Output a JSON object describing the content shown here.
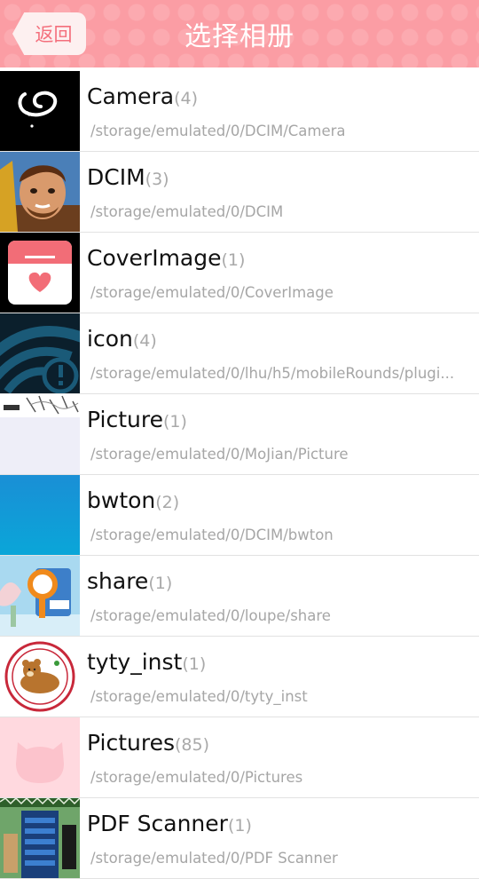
{
  "header": {
    "back_label": "返回",
    "title": "选择相册",
    "bg_color": "#fb9da4"
  },
  "albums": [
    {
      "name": "Camera",
      "count": "(4)",
      "path": "/storage/emulated/0/DCIM/Camera",
      "thumb_icon": "camera-gesture-thumbnail"
    },
    {
      "name": "DCIM",
      "count": "(3)",
      "path": "/storage/emulated/0/DCIM",
      "thumb_icon": "game-character-thumbnail"
    },
    {
      "name": "CoverImage",
      "count": "(1)",
      "path": "/storage/emulated/0/CoverImage",
      "thumb_icon": "heart-calendar-thumbnail"
    },
    {
      "name": "icon",
      "count": "(4)",
      "path": "/storage/emulated/0/lhu/h5/mobileRounds/plugi...",
      "thumb_icon": "wifi-warning-thumbnail"
    },
    {
      "name": "Picture",
      "count": "(1)",
      "path": "/storage/emulated/0/MoJian/Picture",
      "thumb_icon": "sketch-picture-thumbnail"
    },
    {
      "name": "bwton",
      "count": "(2)",
      "path": "/storage/emulated/0/DCIM/bwton",
      "thumb_icon": "blue-gradient-thumbnail"
    },
    {
      "name": "share",
      "count": "(1)",
      "path": "/storage/emulated/0/loupe/share",
      "thumb_icon": "magnifier-thumbnail"
    },
    {
      "name": "tyty_inst",
      "count": "(1)",
      "path": "/storage/emulated/0/tyty_inst",
      "thumb_icon": "bear-badge-thumbnail"
    },
    {
      "name": "Pictures",
      "count": "(85)",
      "path": "/storage/emulated/0/Pictures",
      "thumb_icon": "pink-cat-thumbnail"
    },
    {
      "name": "PDF Scanner",
      "count": "(1)",
      "path": "/storage/emulated/0/PDF Scanner",
      "thumb_icon": "app-screenshot-thumbnail"
    }
  ]
}
